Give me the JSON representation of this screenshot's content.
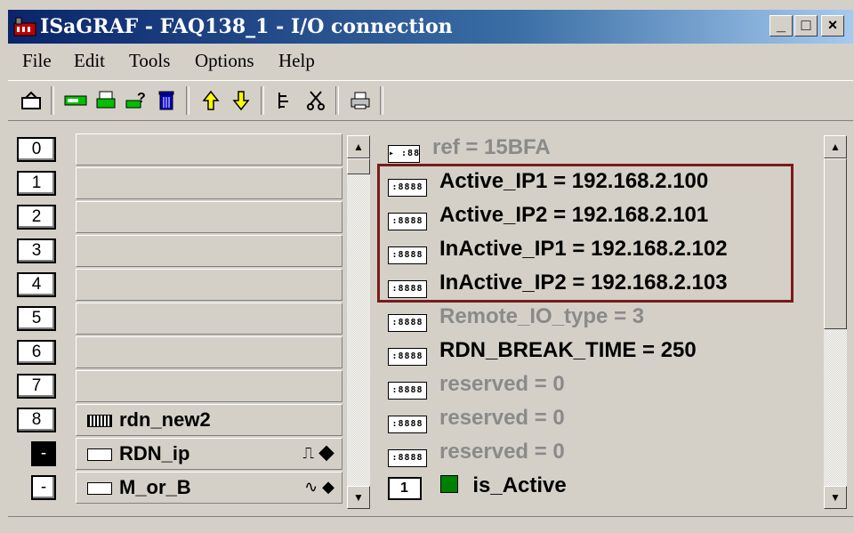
{
  "window": {
    "title": "ISaGRAF - FAQ138_1 - I/O connection",
    "buttons": {
      "minimize": "_",
      "maximize": "□",
      "close": "×"
    }
  },
  "menu": [
    {
      "label": "File"
    },
    {
      "label": "Edit"
    },
    {
      "label": "Tools"
    },
    {
      "label": "Options"
    },
    {
      "label": "Help"
    }
  ],
  "toolbar": {
    "icons": [
      "open-icon",
      "board-icon",
      "board-settings-icon",
      "help-board-icon",
      "delete-icon",
      "move-up-icon",
      "move-down-icon",
      "variable-tree-icon",
      "cut-icon",
      "print-icon"
    ]
  },
  "slots": [
    {
      "index": "0",
      "name": ""
    },
    {
      "index": "1",
      "name": ""
    },
    {
      "index": "2",
      "name": ""
    },
    {
      "index": "3",
      "name": ""
    },
    {
      "index": "4",
      "name": ""
    },
    {
      "index": "5",
      "name": ""
    },
    {
      "index": "6",
      "name": ""
    },
    {
      "index": "7",
      "name": ""
    },
    {
      "index": "8",
      "name": "rdn_new2"
    },
    {
      "index": "-",
      "name": "RDN_ip",
      "signal": "⎍ ◆"
    },
    {
      "index": "-",
      "name": "M_or_B",
      "signal": "∿ ◆"
    }
  ],
  "params": [
    {
      "text": "ref = 15BFA",
      "style": "gray",
      "icon": "▸ :88"
    },
    {
      "text": "Active_IP1 = 192.168.2.100",
      "style": "normal",
      "icon": ":8888"
    },
    {
      "text": "Active_IP2 = 192.168.2.101",
      "style": "normal",
      "icon": ":8888"
    },
    {
      "text": "InActive_IP1 = 192.168.2.102",
      "style": "normal",
      "icon": ":8888"
    },
    {
      "text": "InActive_IP2 = 192.168.2.103",
      "style": "normal",
      "icon": ":8888"
    },
    {
      "text": "Remote_IO_type = 3",
      "style": "gray",
      "icon": ":8888"
    },
    {
      "text": "RDN_BREAK_TIME = 250",
      "style": "normal",
      "icon": ":8888"
    },
    {
      "text": "reserved = 0",
      "style": "gray",
      "icon": ":8888"
    },
    {
      "text": "reserved = 0",
      "style": "gray",
      "icon": ":8888"
    },
    {
      "text": "reserved = 0",
      "style": "gray",
      "icon": ":8888"
    }
  ],
  "channel": {
    "index": "1",
    "name": "is_Active"
  },
  "colors": {
    "highlight_border": "#7a1a1a",
    "title_start": "#0a246a",
    "title_end": "#a6caf0"
  }
}
